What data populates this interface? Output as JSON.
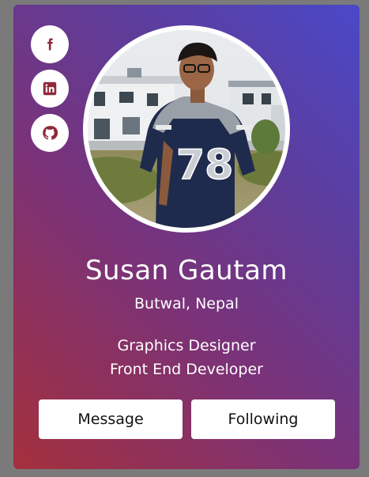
{
  "profile": {
    "name": "Susan Gautam",
    "location": "Butwal, Nepal",
    "roles": [
      "Graphics Designer",
      "Front End Developer"
    ],
    "jersey_number": "78"
  },
  "social": [
    {
      "icon": "facebook-icon"
    },
    {
      "icon": "linkedin-icon"
    },
    {
      "icon": "github-icon"
    }
  ],
  "actions": {
    "message_label": "Message",
    "following_label": "Following"
  },
  "colors": {
    "gradient_start": "#a4303c",
    "gradient_end": "#4a48c8",
    "icon_color": "#8e2a3a",
    "button_bg": "#ffffff"
  }
}
